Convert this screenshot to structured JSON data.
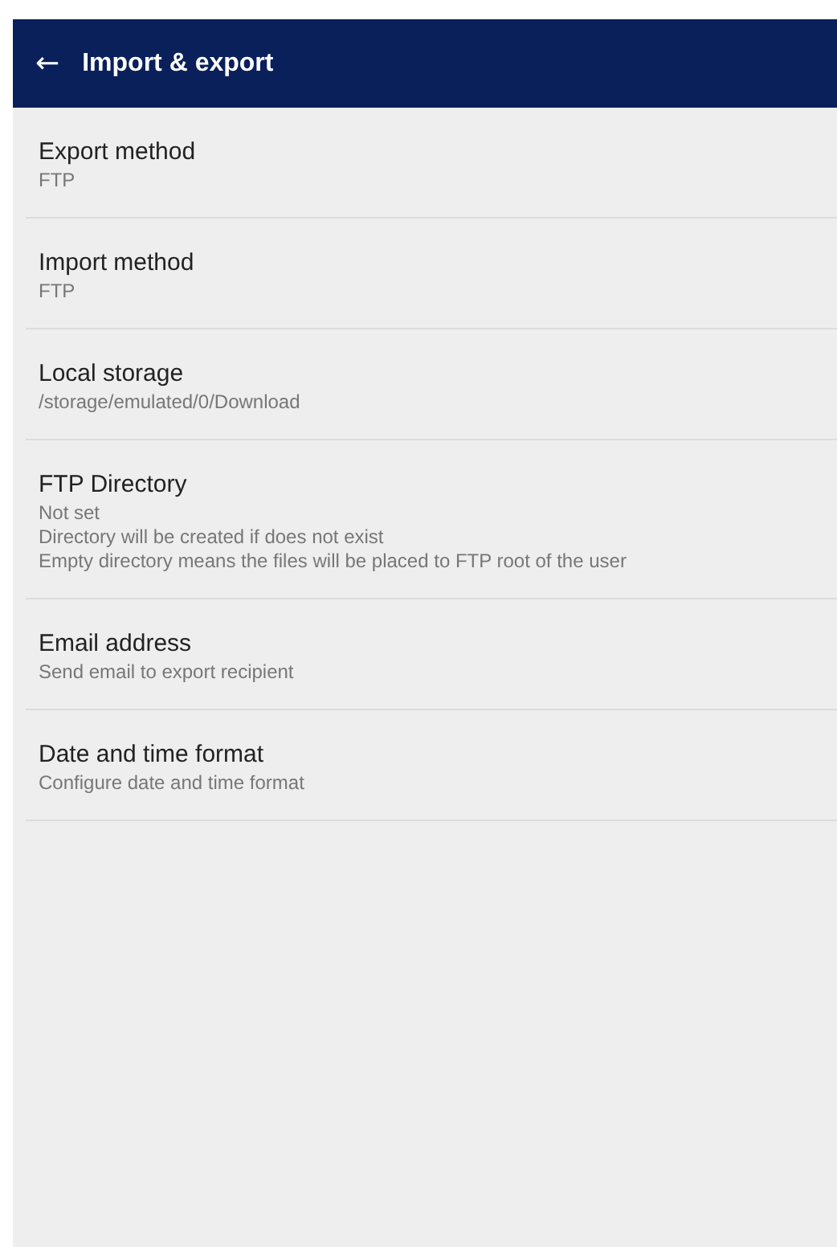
{
  "app_bar": {
    "back_icon": "←",
    "title": "Import & export"
  },
  "settings": [
    {
      "title": "Export method",
      "summary_lines": [
        "FTP"
      ]
    },
    {
      "title": "Import method",
      "summary_lines": [
        "FTP"
      ]
    },
    {
      "title": "Local storage",
      "summary_lines": [
        "/storage/emulated/0/Download"
      ]
    },
    {
      "title": "FTP Directory",
      "summary_lines": [
        "Not set",
        "Directory will be created if does not exist",
        "Empty directory means the files will be placed to FTP root of the user"
      ]
    },
    {
      "title": "Email address",
      "summary_lines": [
        "Send email to export recipient"
      ]
    },
    {
      "title": "Date and time format",
      "summary_lines": [
        "Configure date and time format"
      ]
    }
  ]
}
